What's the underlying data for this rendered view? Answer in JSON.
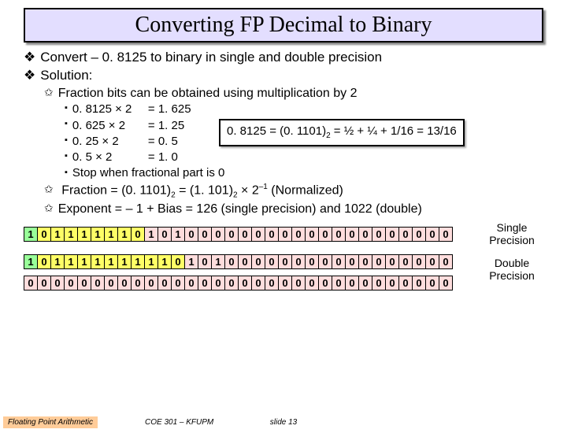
{
  "title": "Converting FP Decimal to Binary",
  "main": {
    "b1": "Convert – 0. 8125 to binary in single and double precision",
    "b2": "Solution:"
  },
  "sub": {
    "frac_method": "Fraction bits can be obtained using multiplication by 2",
    "mul": [
      {
        "a": "0. 8125 × 2",
        "r": "= 1. 625"
      },
      {
        "a": "0. 625 × 2",
        "r": "= 1. 25"
      },
      {
        "a": "0. 25 × 2",
        "r": "= 0. 5"
      },
      {
        "a": "0. 5 × 2",
        "r": "= 1. 0"
      }
    ],
    "stop": "Stop when fractional part is 0",
    "detail_pre": "0. 8125 = (0. 1101)",
    "detail_post": " = ½ + ¼ + 1/16 = 13/16",
    "frac_norm_pre": "Fraction = (0. 1101)",
    "frac_norm_mid": " = (1. 101)",
    "frac_norm_x": " × 2",
    "frac_norm_exp": "–1",
    "frac_norm_end": " (Normalized)",
    "exp_line": "Exponent = – 1 + Bias = 126 (single precision) and 1022 (double)"
  },
  "labels": {
    "single": "Single Precision",
    "double": "Double Precision"
  },
  "single_bits": [
    "1",
    "0",
    "1",
    "1",
    "1",
    "1",
    "1",
    "1",
    "0",
    "1",
    "0",
    "1",
    "0",
    "0",
    "0",
    "0",
    "0",
    "0",
    "0",
    "0",
    "0",
    "0",
    "0",
    "0",
    "0",
    "0",
    "0",
    "0",
    "0",
    "0",
    "0",
    "0"
  ],
  "double_row1": [
    "1",
    "0",
    "1",
    "1",
    "1",
    "1",
    "1",
    "1",
    "1",
    "1",
    "1",
    "0",
    "1",
    "0",
    "1",
    "0",
    "0",
    "0",
    "0",
    "0",
    "0",
    "0",
    "0",
    "0",
    "0",
    "0",
    "0",
    "0",
    "0",
    "0",
    "0",
    "0"
  ],
  "double_row2": [
    "0",
    "0",
    "0",
    "0",
    "0",
    "0",
    "0",
    "0",
    "0",
    "0",
    "0",
    "0",
    "0",
    "0",
    "0",
    "0",
    "0",
    "0",
    "0",
    "0",
    "0",
    "0",
    "0",
    "0",
    "0",
    "0",
    "0",
    "0",
    "0",
    "0",
    "0",
    "0"
  ],
  "footer": {
    "left": "Floating Point Arithmetic",
    "mid": "COE 301 – KFUPM",
    "right": "slide 13"
  }
}
